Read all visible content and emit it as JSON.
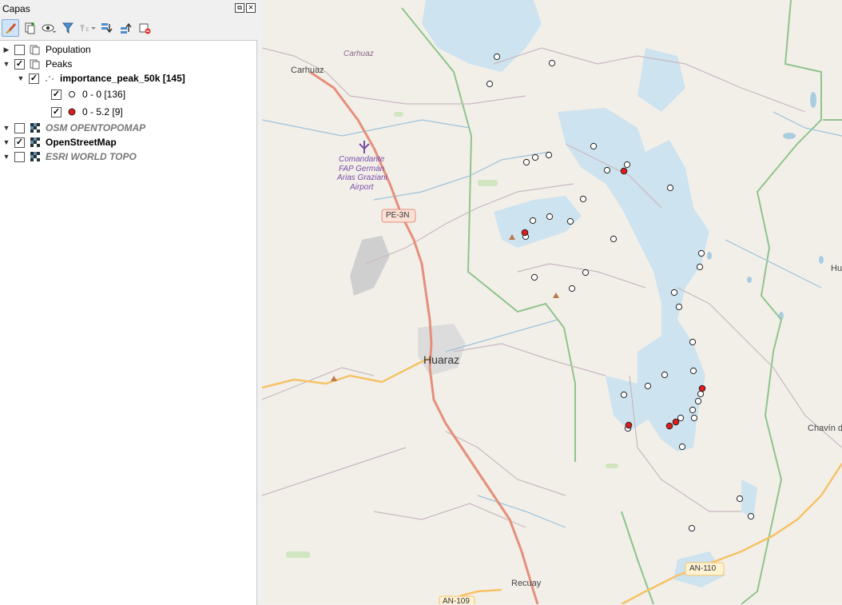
{
  "panel": {
    "title": "Capas",
    "float_glyph": "⧉",
    "close_glyph": "✕"
  },
  "toolbar": {
    "icons": [
      "style-brush-icon",
      "add-group-icon",
      "visibility-eye-icon",
      "filter-icon",
      "filter-expression-icon",
      "expand-all-icon",
      "collapse-all-icon",
      "remove-layer-icon"
    ]
  },
  "layers": [
    {
      "label": "Population",
      "checked": false,
      "expanded": false,
      "kind": "group"
    },
    {
      "label": "Peaks",
      "checked": true,
      "expanded": true,
      "kind": "group"
    },
    {
      "label": "importance_peak_50k [145]",
      "checked": true,
      "expanded": true,
      "kind": "point-layer"
    },
    {
      "label": "0 - 0 [136]",
      "checked": true,
      "kind": "class-white"
    },
    {
      "label": "0 - 5.2 [9]",
      "checked": true,
      "kind": "class-red"
    },
    {
      "label": "OSM OPENTOPOMAP",
      "checked": false,
      "expanded": true,
      "kind": "raster"
    },
    {
      "label": "OpenStreetMap",
      "checked": true,
      "expanded": true,
      "kind": "raster"
    },
    {
      "label": "ESRI WORLD TOPO",
      "checked": false,
      "expanded": true,
      "kind": "raster"
    }
  ],
  "map": {
    "labels": {
      "carhuaz_italic": "Carhuaz",
      "carhuaz": "Carhuaz",
      "airport_1": "Comandante",
      "airport_2": "FAP Germán",
      "airport_3": "Arias Graziani",
      "airport_4": "Airport",
      "road_pe3n": "PE-3N",
      "huaraz": "Huaraz",
      "hu": "Hu",
      "chavin": "Chavín d",
      "recuay": "Recuay",
      "road_an110": "AN-110",
      "road_an109": "AN-109"
    },
    "colors": {
      "background": "#f2efe9",
      "water": "#cde3ef",
      "park_border": "#8fc48c",
      "main_road": "#e58f7b",
      "secondary_road": "#f5c266",
      "peak_white": "#ffffff",
      "peak_red": "#e31a1c"
    }
  }
}
